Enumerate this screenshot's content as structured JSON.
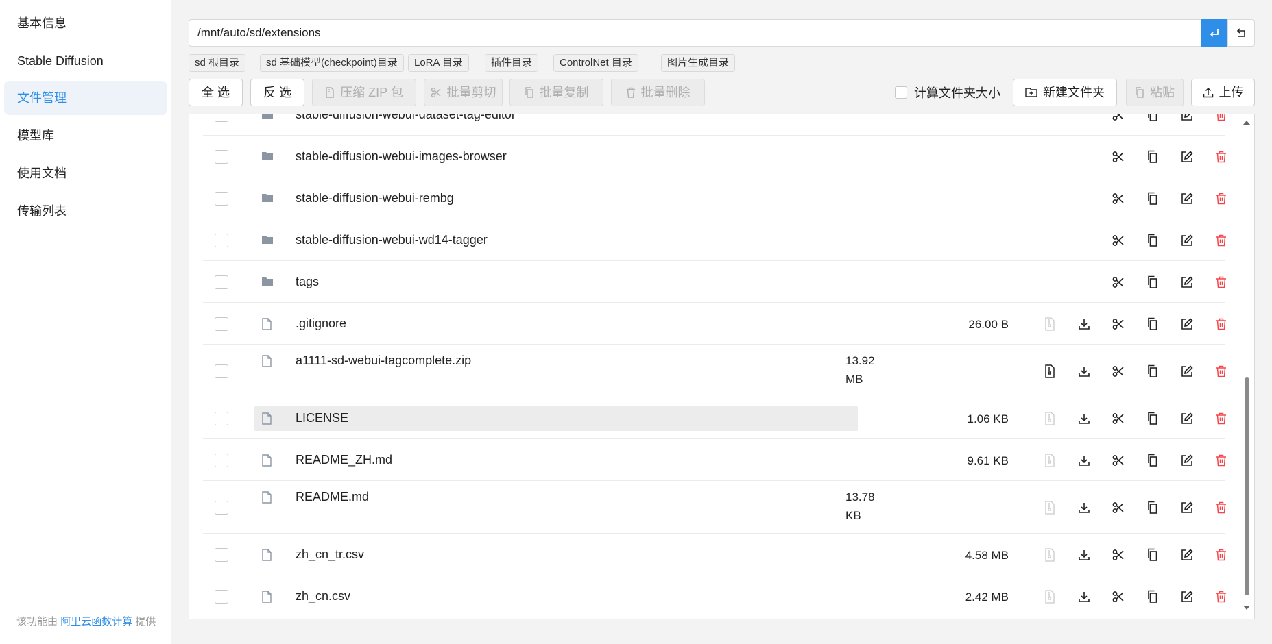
{
  "sidebar": {
    "items": [
      {
        "label": "基本信息",
        "active": false
      },
      {
        "label": "Stable Diffusion",
        "active": false
      },
      {
        "label": "文件管理",
        "active": true
      },
      {
        "label": "模型库",
        "active": false
      },
      {
        "label": "使用文档",
        "active": false
      },
      {
        "label": "传输列表",
        "active": false
      }
    ],
    "footer_prefix": "该功能由",
    "footer_link": "阿里云函数计算",
    "footer_suffix": "提供"
  },
  "path": {
    "value": "/mnt/auto/sd/extensions"
  },
  "shortcuts": [
    "sd 根目录",
    "sd 基础模型(checkpoint)目录",
    "LoRA 目录",
    "插件目录",
    "ControlNet 目录",
    "图片生成目录"
  ],
  "toolbar": {
    "select_all": "全 选",
    "invert": "反 选",
    "zip": "压缩 ZIP 包",
    "cut": "批量剪切",
    "copy": "批量复制",
    "delete": "批量删除",
    "calc_size": "计算文件夹大小",
    "new_folder": "新建文件夹",
    "paste": "粘贴",
    "upload": "上传"
  },
  "files": [
    {
      "name": "stable-diffusion-webui-dataset-tag-editor",
      "type": "folder",
      "size": ""
    },
    {
      "name": "stable-diffusion-webui-images-browser",
      "type": "folder",
      "size": ""
    },
    {
      "name": "stable-diffusion-webui-rembg",
      "type": "folder",
      "size": ""
    },
    {
      "name": "stable-diffusion-webui-wd14-tagger",
      "type": "folder",
      "size": ""
    },
    {
      "name": "tags",
      "type": "folder",
      "size": ""
    },
    {
      "name": ".gitignore",
      "type": "file",
      "size": "26.00 B",
      "unzip_enabled": false
    },
    {
      "name": "a1111-sd-webui-tagcomplete.zip",
      "type": "file",
      "size": "13.92 MB",
      "unzip_enabled": true
    },
    {
      "name": "LICENSE",
      "type": "file",
      "size": "1.06 KB",
      "unzip_enabled": false,
      "hovered": true
    },
    {
      "name": "README_ZH.md",
      "type": "file",
      "size": "9.61 KB",
      "unzip_enabled": false
    },
    {
      "name": "README.md",
      "type": "file",
      "size": "13.78 KB",
      "unzip_enabled": false
    },
    {
      "name": "zh_cn_tr.csv",
      "type": "file",
      "size": "4.58 MB",
      "unzip_enabled": false
    },
    {
      "name": "zh_cn.csv",
      "type": "file",
      "size": "2.42 MB",
      "unzip_enabled": false
    }
  ],
  "colors": {
    "accent": "#2f8ee8",
    "danger": "#f5444a",
    "folder": "#8c96a3"
  },
  "icons": {
    "folder": "folder-icon",
    "file": "file-icon",
    "unzip": "unzip-icon",
    "download": "download-icon",
    "cut": "scissors-icon",
    "copy": "copy-icon",
    "edit": "edit-icon",
    "delete": "trash-icon"
  }
}
